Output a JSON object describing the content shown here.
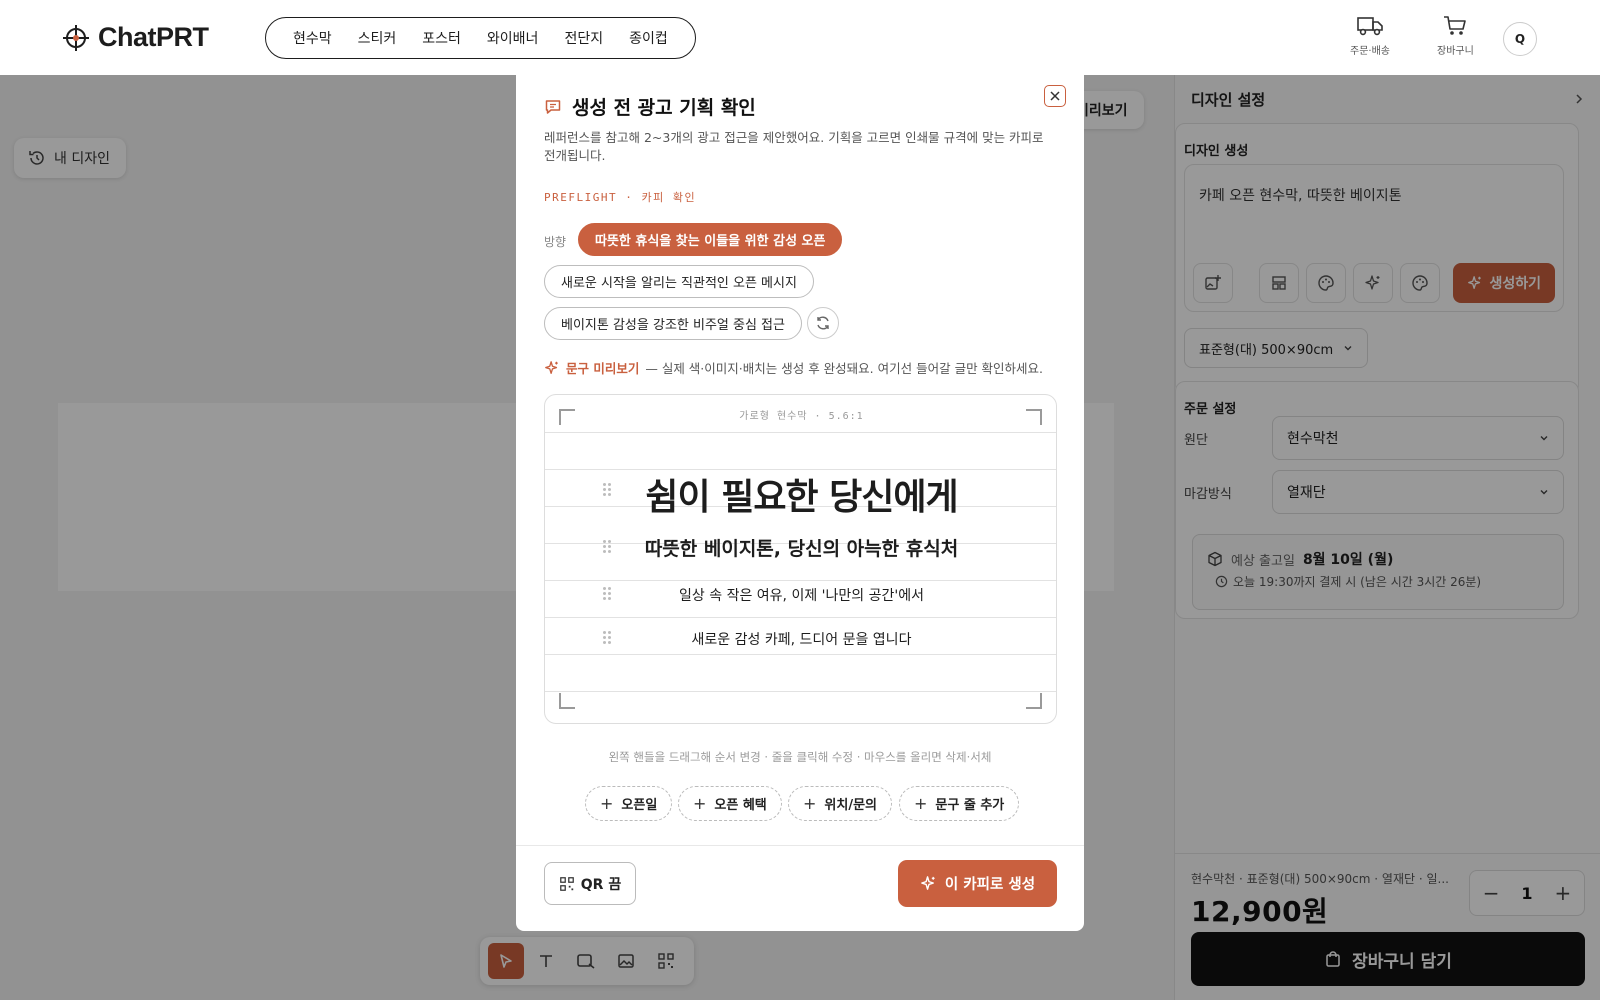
{
  "brand": {
    "name": "ChatPRT",
    "accent": "#c9603f"
  },
  "nav": {
    "categories": [
      "현수막",
      "스티커",
      "포스터",
      "와이배너",
      "전단지",
      "종이컵"
    ],
    "order_label": "주문·배송",
    "cart_label": "장바구니",
    "avatar_initial": "Q"
  },
  "canvas": {
    "my_design_label": "내 디자인",
    "preview_label": "미리보기",
    "tools": [
      "select-tool",
      "text-tool",
      "shape-tool",
      "image-tool",
      "qr-tool"
    ]
  },
  "right_panel": {
    "title": "디자인 설정",
    "design_gen": {
      "title": "디자인 생성",
      "prompt": "카페 오픈 현수막, 따뜻한 베이지톤",
      "generate_label": "생성하기",
      "size": "표준형(대) 500×90cm"
    },
    "order": {
      "title": "주문 설정",
      "fabric_label": "원단",
      "fabric_value": "현수막천",
      "finish_label": "마감방식",
      "finish_value": "열재단",
      "ship_label": "예상 출고일",
      "ship_date": "8월 10일 (월)",
      "ship_note": "오늘 19:30까지 결제 시 (남은 시간 3시간 26분)"
    },
    "summary": "현수막천 · 표준형(대) 500×90cm · 열재단 · 일...",
    "price": "12,900원",
    "quantity": "1",
    "cart_button": "장바구니 담기"
  },
  "modal": {
    "title": "생성 전 광고 기획 확인",
    "description": "레퍼런스를 참고해 2~3개의 광고 접근을 제안했어요. 기획을 고르면 인쇄물 규격에 맞는 카피로 전개됩니다.",
    "preflight": "PREFLIGHT · 카피 확인",
    "direction_label": "방향",
    "directions": [
      "따뜻한 휴식을 찾는 이들을 위한 감성 오픈",
      "새로운 시작을 알리는 직관적인 오픈 메시지",
      "베이지톤 감성을 강조한 비주얼 중심 접근"
    ],
    "copy_preview_label": "문구 미리보기",
    "copy_preview_note": "— 실제 색·이미지·배치는 생성 후 완성돼요. 여기선 들어갈 글만 확인하세요.",
    "preview_tag": "가로형 현수막 · 5.6:1",
    "copy_lines": [
      "쉼이 필요한 당신에게",
      "따뜻한 베이지톤, 당신의 아늑한 휴식처",
      "일상 속 작은 여유, 이제 '나만의 공간'에서",
      "새로운 감성 카페, 드디어 문을 엽니다"
    ],
    "drag_hint": "왼쪽 핸들을 드래그해 순서 변경 · 줄을 클릭해 수정 · 마우스를 올리면 삭제·서체",
    "add_chips": [
      "오픈일",
      "오픈 혜택",
      "위치/문의",
      "문구 줄 추가"
    ],
    "qr_label": "QR 끔",
    "submit_label": "이 카피로 생성"
  }
}
